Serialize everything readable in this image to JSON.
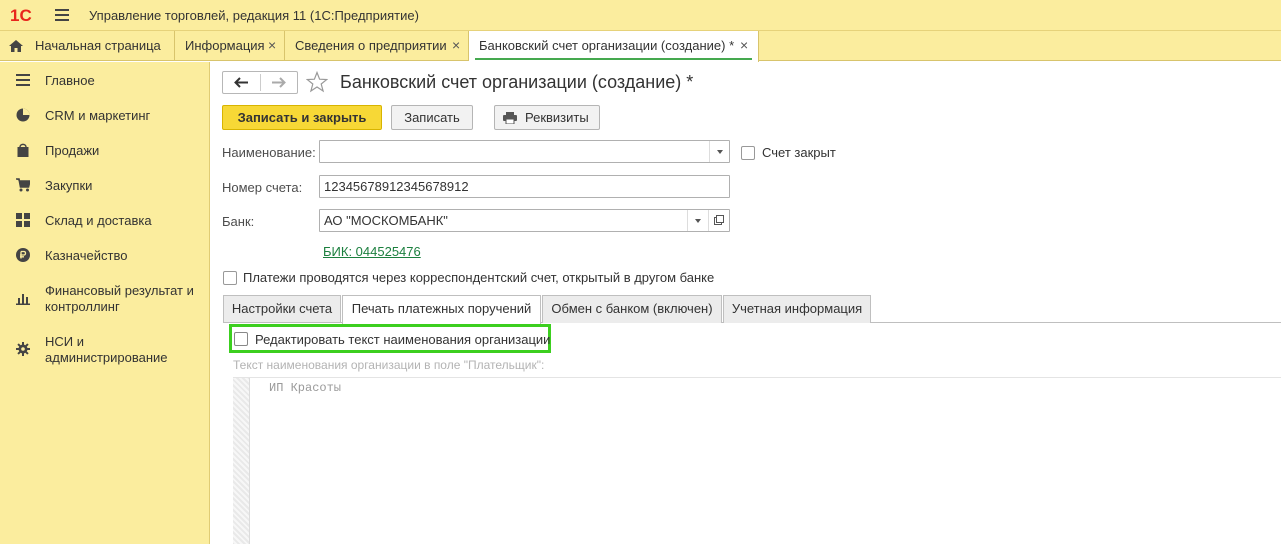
{
  "app": {
    "logo_text": "1С",
    "title": "Управление торговлей, редакция 11  (1С:Предприятие)"
  },
  "window_tabs": [
    {
      "label": "Начальная страница",
      "icon": "home-icon"
    },
    {
      "label": "Информация",
      "close": "×"
    },
    {
      "label": "Сведения о предприятии",
      "close": "×"
    },
    {
      "label": "Банковский счет организации (создание) *",
      "close": "×",
      "active": true
    }
  ],
  "sidebar": {
    "items": [
      {
        "label": "Главное",
        "icon": "list-icon"
      },
      {
        "label": "CRM и маркетинг",
        "icon": "pie-chart-icon"
      },
      {
        "label": "Продажи",
        "icon": "shopping-bag-icon"
      },
      {
        "label": "Закупки",
        "icon": "cart-icon"
      },
      {
        "label": "Склад и доставка",
        "icon": "grid-icon"
      },
      {
        "label": "Казначейство",
        "icon": "ruble-coin-icon"
      },
      {
        "label": "Финансовый результат и контроллинг",
        "icon": "bar-chart-icon"
      },
      {
        "label": "НСИ и администрирование",
        "icon": "gear-icon"
      }
    ]
  },
  "form": {
    "title": "Банковский счет организации (создание) *",
    "toolbar": {
      "save_close": "Записать и закрыть",
      "save": "Записать",
      "details": "Реквизиты"
    },
    "name_label": "Наименование:",
    "name_value": "",
    "account_closed_label": "Счет закрыт",
    "account_number_label": "Номер счета:",
    "account_number_value": "12345678912345678912",
    "bank_label": "Банк:",
    "bank_value": "АО \"МОСКОМБАНК\"",
    "bik_link": "БИК: 044525476",
    "correspondent_label": "Платежи проводятся через корреспондентский счет, открытый в другом банке",
    "tabs": [
      {
        "label": "Настройки счета"
      },
      {
        "label": "Печать платежных поручений",
        "active": true
      },
      {
        "label": "Обмен с банком (включен)"
      },
      {
        "label": "Учетная информация"
      }
    ],
    "edit_name_label": "Редактировать текст наименования организации",
    "payer_text_label": "Текст наименования организации в поле \"Плательщик\":",
    "payer_text_value": "ИП Красоты"
  },
  "colors": {
    "panel": "#fbed9e",
    "primary_button": "#f7d836",
    "link": "#1b7f3e",
    "highlight": "#3ccf1f",
    "logo": "#e8261c"
  }
}
